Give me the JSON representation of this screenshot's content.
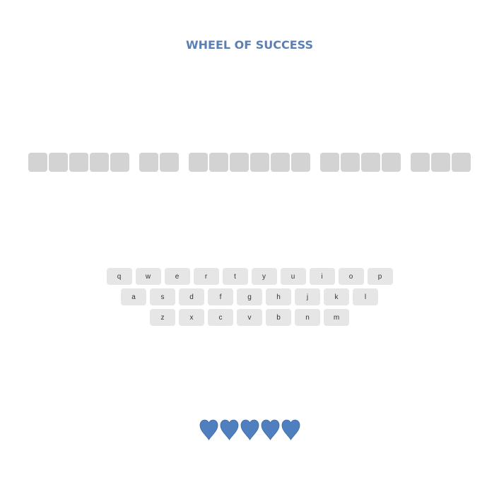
{
  "game": {
    "title": "WHEEL OF SUCCESS"
  },
  "puzzle": {
    "word_lengths": [
      5,
      2,
      6,
      4,
      3
    ]
  },
  "keyboard": {
    "rows": [
      [
        "q",
        "w",
        "e",
        "r",
        "t",
        "y",
        "u",
        "i",
        "o",
        "p"
      ],
      [
        "a",
        "s",
        "d",
        "f",
        "g",
        "h",
        "j",
        "k",
        "l"
      ],
      [
        "z",
        "x",
        "c",
        "v",
        "b",
        "n",
        "m"
      ]
    ]
  },
  "lives": {
    "count": 5,
    "icon": "heart-icon",
    "color": "#4f7fbf"
  },
  "colors": {
    "title": "#5b7fb4",
    "tile": "#d3d3d3",
    "key": "#e6e6e6",
    "heart": "#4f7fbf"
  }
}
